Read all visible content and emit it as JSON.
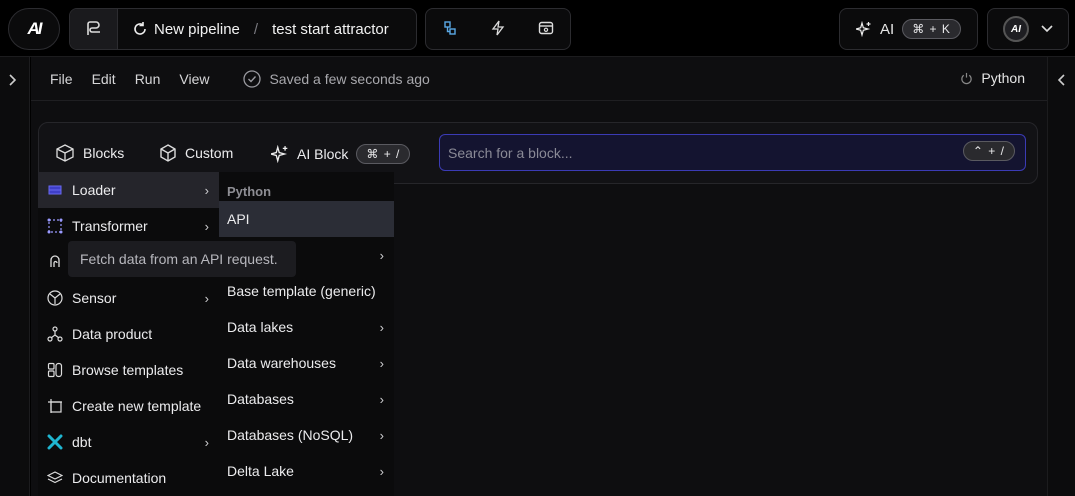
{
  "topbar": {
    "logo_text": "AI",
    "pipeline_icon": "pipeline-icon",
    "new_pipeline_label": "New pipeline",
    "separator": "/",
    "pipeline_name": "test start attractor",
    "tool_icons": [
      "tree-icon",
      "lightning-icon",
      "browser-icon"
    ],
    "ai_label": "AI",
    "ai_shortcut": "⌘ + K",
    "avatar_text": "AI"
  },
  "menubar": {
    "items": [
      "File",
      "Edit",
      "Run",
      "View"
    ],
    "saved_status": "Saved a few seconds ago",
    "kernel_label": "Python"
  },
  "blockbar": {
    "blocks_label": "Blocks",
    "custom_label": "Custom",
    "ai_block_label": "AI Block",
    "ai_block_shortcut": "⌘ + /",
    "search_placeholder": "Search for a block...",
    "search_shortcut": "⌃ + /"
  },
  "block_menu": {
    "items": [
      {
        "label": "Loader",
        "icon": "loader-icon",
        "submenu": true,
        "active": true
      },
      {
        "label": "Transformer",
        "icon": "transformer-icon",
        "submenu": true
      },
      {
        "label": "",
        "icon": "exporter-icon",
        "submenu": false
      },
      {
        "label": "Sensor",
        "icon": "sensor-icon",
        "submenu": true
      },
      {
        "label": "Data product",
        "icon": "data-product-icon",
        "submenu": false
      },
      {
        "label": "Browse templates",
        "icon": "templates-icon",
        "submenu": false
      },
      {
        "label": "Create new template",
        "icon": "create-template-icon",
        "submenu": false
      },
      {
        "label": "dbt",
        "icon": "dbt-icon",
        "submenu": true
      },
      {
        "label": "Documentation",
        "icon": "documentation-icon",
        "submenu": false
      }
    ]
  },
  "loader_menu": {
    "header": "Python",
    "items": [
      {
        "label": "API",
        "submenu": false,
        "active": true
      },
      {
        "label": "",
        "submenu": true
      },
      {
        "label": "Base template (generic)",
        "submenu": false
      },
      {
        "label": "Data lakes",
        "submenu": true
      },
      {
        "label": "Data warehouses",
        "submenu": true
      },
      {
        "label": "Databases",
        "submenu": true
      },
      {
        "label": "Databases (NoSQL)",
        "submenu": true
      },
      {
        "label": "Delta Lake",
        "submenu": true
      }
    ]
  },
  "tooltip": {
    "text": "Fetch data from an API request."
  },
  "colors": {
    "accent": "#3b3bb5",
    "dbt": "#1fb6d1",
    "loader_icon": "#3f3fc8"
  }
}
